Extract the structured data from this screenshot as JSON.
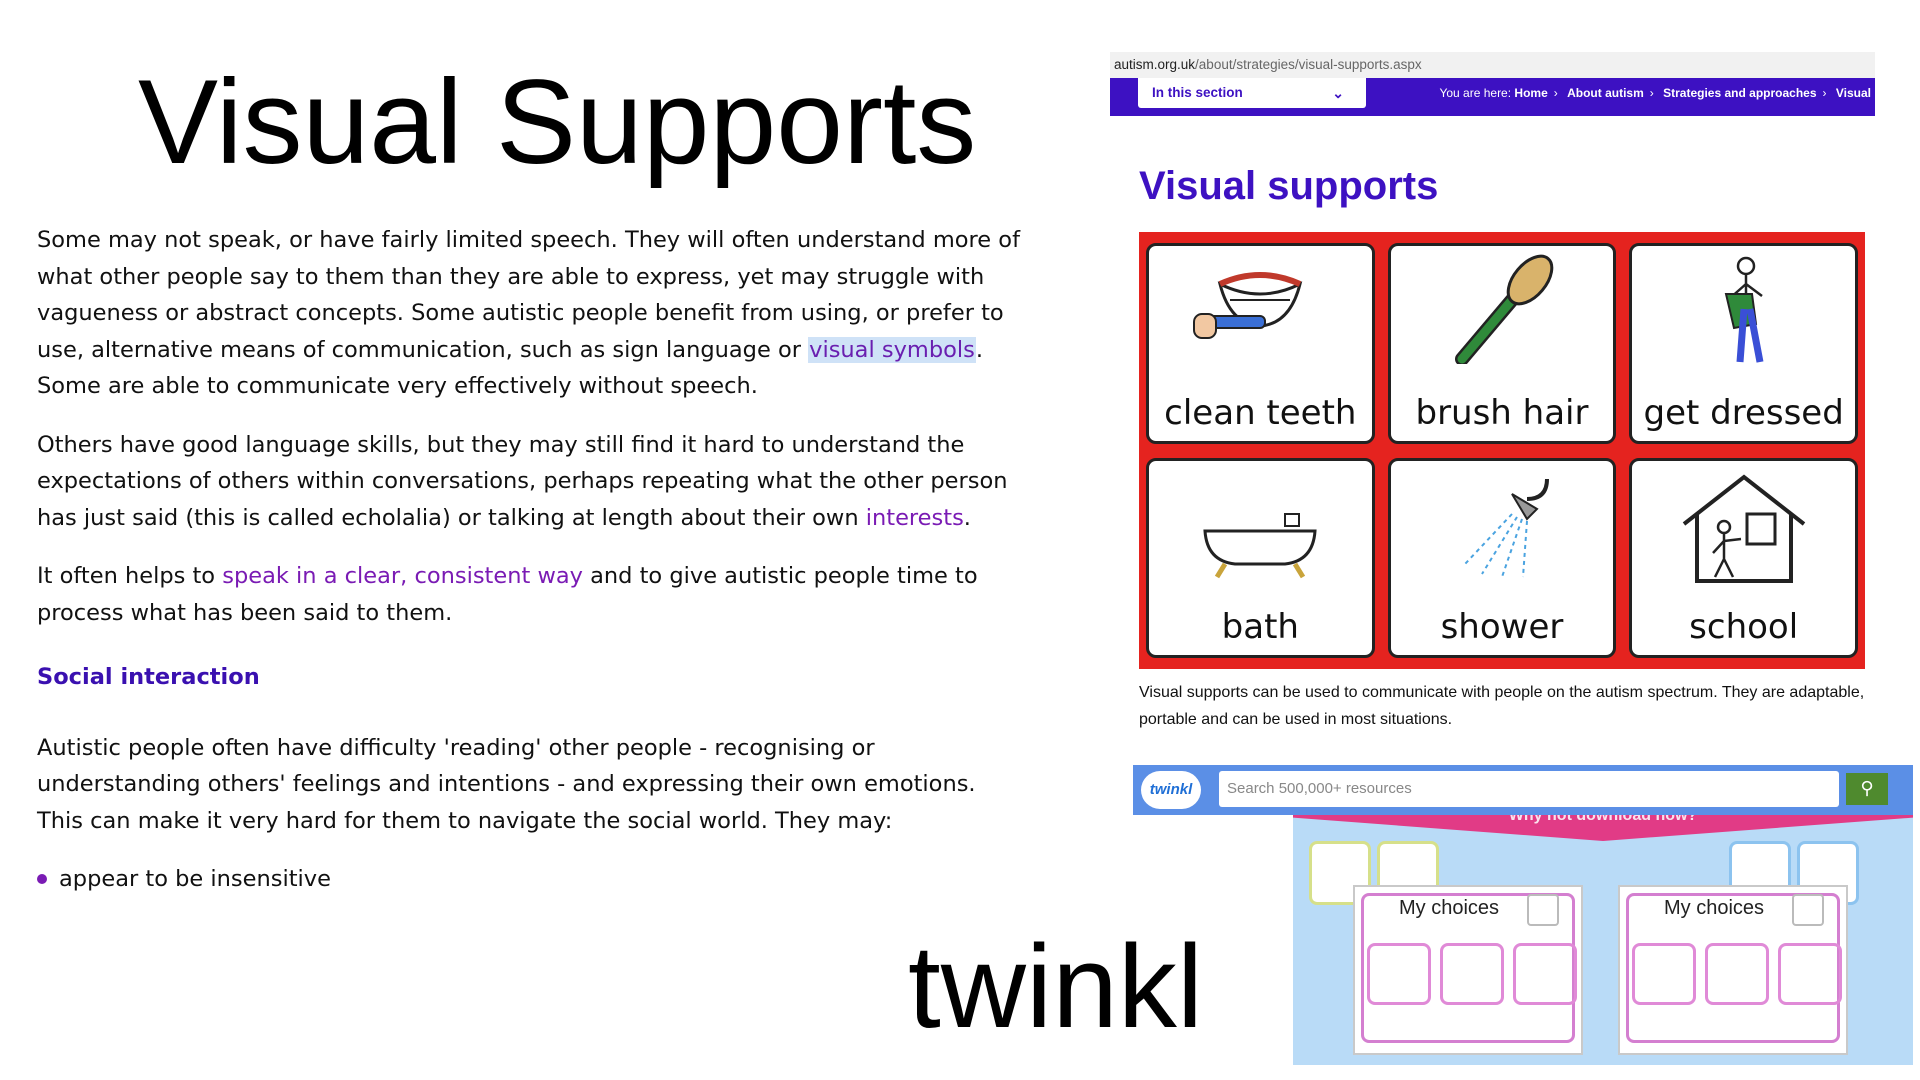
{
  "slide": {
    "title": "Visual Supports",
    "brand_word": "twinkl"
  },
  "article": {
    "p1_before": "Some may not speak, or have fairly limited speech. They will often understand more of what other people say to them than they are able to express, yet may struggle with vagueness or abstract concepts. Some autistic people benefit from using, or prefer to use, alternative means of communication, such as sign language or ",
    "p1_link": "visual symbols",
    "p1_after": ". Some are able to communicate very effectively without speech.",
    "p2_before": "Others have good language skills, but they may still find it hard to understand the expectations of others within conversations, perhaps repeating what the other person has just said (this is called echolalia) or talking at length about their own ",
    "p2_link": "interests",
    "p2_after": ".",
    "p3_before": "It often helps to ",
    "p3_link": "speak in a clear, consistent way",
    "p3_after": " and to give autistic people time to process what has been said to them.",
    "subheading": "Social interaction",
    "p4": "Autistic people often have difficulty 'reading' other people - recognising or understanding others' feelings and intentions - and expressing their own emotions. This can make it very hard for them to navigate the social world. They may:",
    "bullet1": "appear to be insensitive"
  },
  "autism_site": {
    "url_host": "autism.org.uk",
    "url_path": "/about/strategies/visual-supports.aspx",
    "section_dropdown": "In this section",
    "crumbs_prefix": "You are here:",
    "crumbs": [
      "Home",
      "About autism",
      "Strategies and approaches",
      "Visual"
    ],
    "heading": "Visual supports",
    "cards": [
      "clean teeth",
      "brush hair",
      "get dressed",
      "bath",
      "shower",
      "school"
    ],
    "caption": "Visual supports can be used to communicate with people on the autism spectrum. They are adaptable, portable and can be used in most situations."
  },
  "twinkl_site": {
    "logo": "twinkl",
    "search_placeholder": "Search 500,000+ resources",
    "banner": "Why not download now?",
    "worksheet_title": "My choices"
  },
  "colors": {
    "purple_brand": "#3d11c2",
    "link_purple": "#7a1bb4",
    "card_grid_red": "#e5231f",
    "twinkl_blue": "#5b8fe6",
    "twinkl_green": "#4f8a2e"
  }
}
